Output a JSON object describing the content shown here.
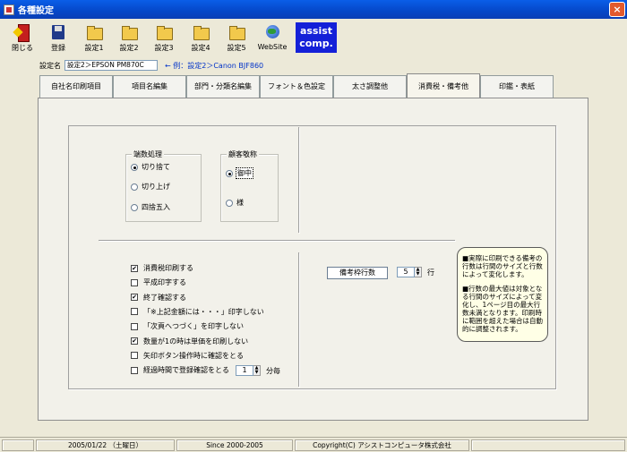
{
  "window": {
    "title": "各種設定",
    "close": "×"
  },
  "toolbar": {
    "close_label": "閉じる",
    "save_label": "登録",
    "set1": "設定1",
    "set2": "設定2",
    "set3": "設定3",
    "set4": "設定4",
    "set5": "設定5",
    "website": "WebSite",
    "assist_line1": "assist",
    "assist_line2": "comp."
  },
  "setting_name": {
    "label": "設定名",
    "value": "設定2＞EPSON PM870C",
    "example": "← 例：設定2＞Canon BJF860"
  },
  "tabs": [
    "自社名印刷項目",
    "項目名編集",
    "部門・分類名編集",
    "フォント＆色設定",
    "太さ調整他",
    "消費税・備考他",
    "印鑑・表紙"
  ],
  "rounding": {
    "title": "端数処理",
    "options": [
      "切り捨て",
      "切り上げ",
      "四捨五入"
    ]
  },
  "honorific": {
    "title": "顧客敬称",
    "options": [
      "御中",
      "様"
    ]
  },
  "checkboxes": [
    {
      "label": "消費税印刷する",
      "checked": true
    },
    {
      "label": "平成印字する",
      "checked": false
    },
    {
      "label": "終了確認する",
      "checked": true
    },
    {
      "label": "「※上記金額には・・・」印字しない",
      "checked": false
    },
    {
      "label": "「次頁へつづく」を印字しない",
      "checked": false
    },
    {
      "label": "数量が1の時は単価を印刷しない",
      "checked": true
    },
    {
      "label": "矢印ボタン操作時に確認をとる",
      "checked": false
    },
    {
      "label": "経過時間で登録確認をとる",
      "checked": false
    }
  ],
  "elapsed": {
    "value": "1",
    "unit": "分毎"
  },
  "remarks": {
    "button": "備考枠行数",
    "value": "5",
    "unit": "行"
  },
  "note": {
    "p1": "■実際に印刷できる備考の行数は行間のサイズと行数によって変化します。",
    "p2": "■行数の最大値は対象となる行間のサイズによって変化し、1ページ目の最大行数未満となります。印刷時に範囲を超えた場合は自動的に調整されます。"
  },
  "status": {
    "date": "2005/01/22 （土曜日）",
    "since": "Since 2000-2005",
    "copyright": "Copyright(C) アシストコンピュータ株式会社"
  }
}
